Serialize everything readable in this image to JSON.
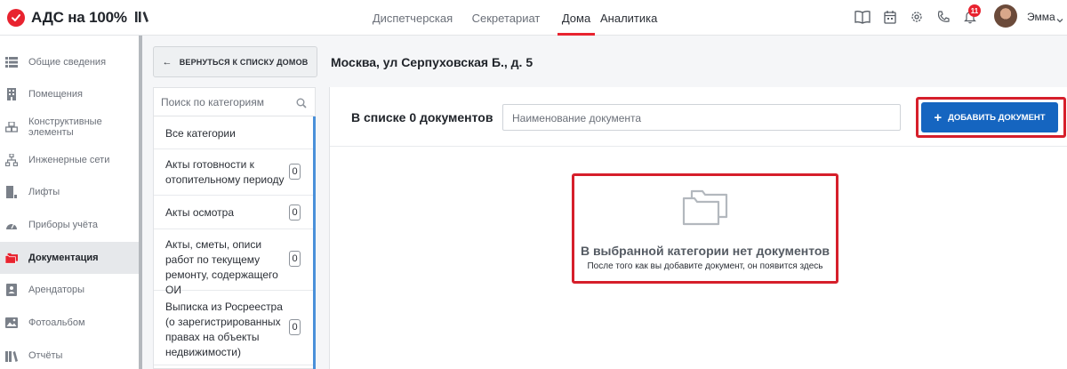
{
  "app": {
    "logo_text": "АДС на 100%"
  },
  "nav": {
    "items": [
      {
        "label": "Диспетчерская"
      },
      {
        "label": "Секретариат"
      },
      {
        "label": "Дома"
      },
      {
        "label": "Аналитика"
      }
    ],
    "active": "Дома"
  },
  "user": {
    "name": "Эмма",
    "notification_count": "11"
  },
  "sidebar": {
    "items": [
      {
        "label": "Общие сведения",
        "icon": "grid-list-icon"
      },
      {
        "label": "Помещения",
        "icon": "building-icon"
      },
      {
        "label": "Конструктивные элементы",
        "icon": "cubes-icon"
      },
      {
        "label": "Инженерные сети",
        "icon": "network-icon"
      },
      {
        "label": "Лифты",
        "icon": "elevator-icon"
      },
      {
        "label": "Приборы учёта",
        "icon": "gauge-icon"
      },
      {
        "label": "Документация",
        "icon": "folders-icon",
        "active": true
      },
      {
        "label": "Арендаторы",
        "icon": "id-card-icon"
      },
      {
        "label": "Фотоальбом",
        "icon": "image-icon"
      },
      {
        "label": "Отчёты",
        "icon": "books-icon"
      }
    ]
  },
  "back_button": {
    "label": "ВЕРНУТЬСЯ К СПИСКУ ДОМОВ"
  },
  "page": {
    "title": "Москва, ул Серпуховская Б., д. 5"
  },
  "categories": {
    "search_placeholder": "Поиск по категориям",
    "items": [
      {
        "label": "Все категории"
      },
      {
        "label": "Акты готовности к отопительному периоду",
        "count": "0"
      },
      {
        "label": "Акты осмотра",
        "count": "0"
      },
      {
        "label": "Акты, сметы, описи работ по текущему ремонту, содержащего ОИ",
        "count": "0"
      },
      {
        "label": "Выписка из Росреестра (о зарегистрированных правах на объекты недвижимости)",
        "count": "0"
      }
    ]
  },
  "documents": {
    "count_text": "В списке 0 документов",
    "search_placeholder": "Наименование документа",
    "add_button_label": "ДОБАВИТЬ ДОКУМЕНТ",
    "empty_title": "В выбранной категории нет документов",
    "empty_subtitle": "После того как вы добавите документ, он появится здесь"
  },
  "colors": {
    "brand_red": "#e8232f",
    "primary_blue": "#1565c0",
    "highlight_frame": "#d61f2b"
  }
}
